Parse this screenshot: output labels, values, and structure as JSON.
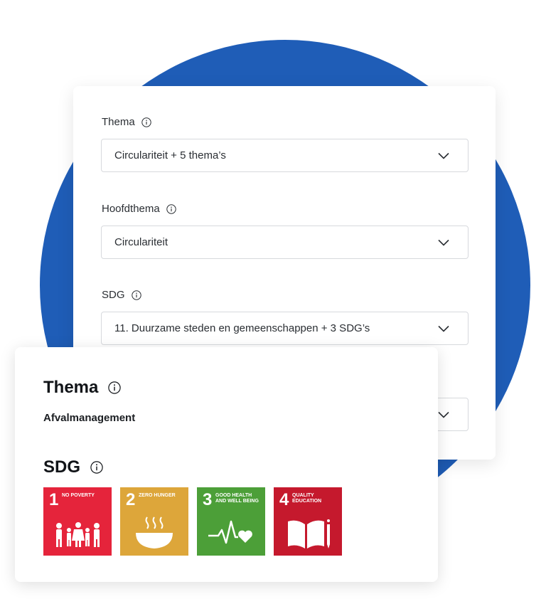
{
  "form": {
    "fields": [
      {
        "label": "Thema",
        "value": "Circulariteit + 5 thema’s"
      },
      {
        "label": "Hoofdthema",
        "value": "Circulariteit"
      },
      {
        "label": "SDG",
        "value": "11. Duurzame steden en gemeenschappen + 3 SDG’s"
      }
    ]
  },
  "summary": {
    "thema_heading": "Thema",
    "thema_value": "Afvalmanagement",
    "sdg_heading": "SDG",
    "sdgs": [
      {
        "number": "1",
        "title": "No poverty",
        "color": "#e5243b",
        "icon": "family-icon"
      },
      {
        "number": "2",
        "title": "Zero hunger",
        "color": "#dda63a",
        "icon": "bowl-icon"
      },
      {
        "number": "3",
        "title": "Good health and well being",
        "color": "#4c9f38",
        "icon": "heartbeat-icon"
      },
      {
        "number": "4",
        "title": "Quality education",
        "color": "#c5192d",
        "icon": "book-pencil-icon"
      }
    ]
  },
  "colors": {
    "background_circle": "#1f5db7"
  }
}
